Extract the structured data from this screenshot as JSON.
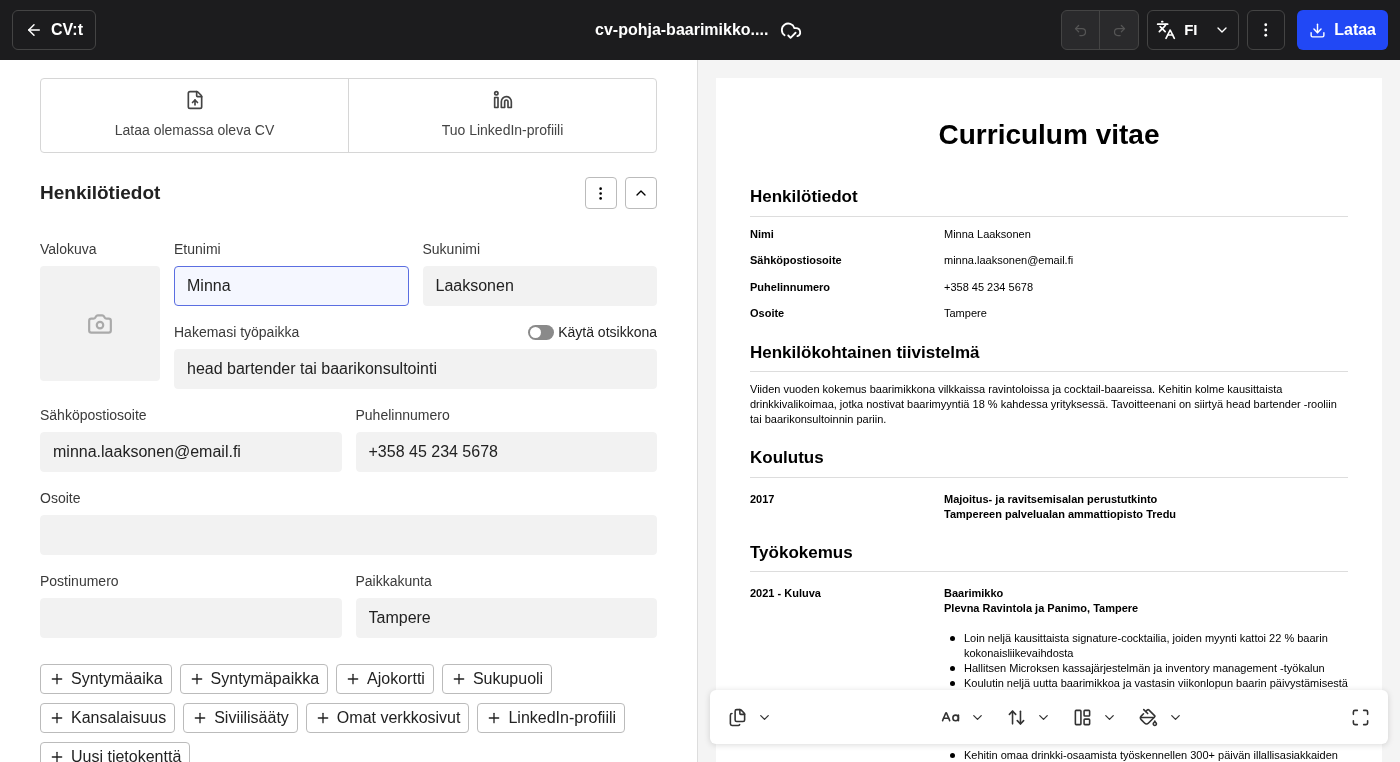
{
  "topbar": {
    "back_label": "CV:t",
    "file_name": "cv-pohja-baarimikko....",
    "language": "FI",
    "download_label": "Lataa"
  },
  "import_options": [
    {
      "kind": "upload",
      "label": "Lataa olemassa oleva CV"
    },
    {
      "kind": "linkedin",
      "label": "Tuo LinkedIn-profiili"
    }
  ],
  "section": {
    "title": "Henkilötiedot",
    "expanded": true
  },
  "photo": {
    "label": "Valokuva"
  },
  "fields": {
    "first_name": {
      "label": "Etunimi",
      "value": "Minna",
      "focused": true
    },
    "last_name": {
      "label": "Sukunimi",
      "value": "Laaksonen",
      "focused": false
    },
    "job": {
      "label": "Hakemasi työpaikka",
      "value": "head bartender tai baarikonsultointi",
      "focused": false
    },
    "email": {
      "label": "Sähköpostiosoite",
      "value": "minna.laaksonen@email.fi",
      "focused": false
    },
    "phone": {
      "label": "Puhelinnumero",
      "value": "+358 45 234 5678",
      "focused": false
    },
    "address": {
      "label": "Osoite",
      "focused": false
    },
    "postal": {
      "label": "Postinumero",
      "focused": false
    },
    "city": {
      "label": "Paikkakunta",
      "value": "Tampere",
      "focused": false
    }
  },
  "title_toggle": {
    "label": "Käytä otsikkona",
    "on": false
  },
  "add_buttons": [
    "Syntymäaika",
    "Syntymäpaikka",
    "Ajokortti",
    "Sukupuoli",
    "Kansalaisuus",
    "Siviilisääty",
    "Omat verkkosivut",
    "LinkedIn-profiili",
    "Uusi tietokenttä"
  ],
  "preview": {
    "title": "Curriculum vitae",
    "personal": {
      "heading": "Henkilötiedot",
      "rows": [
        {
          "label": "Nimi",
          "value": "Minna Laaksonen"
        },
        {
          "label": "Sähköpostiosoite",
          "value": "minna.laaksonen@email.fi"
        },
        {
          "label": "Puhelinnumero",
          "value": "+358 45 234 5678"
        },
        {
          "label": "Osoite",
          "value": "Tampere"
        }
      ]
    },
    "summary": {
      "heading": "Henkilökohtainen tiivistelmä",
      "text": "Viiden vuoden kokemus baarimikkona vilkkaissa ravintoloissa ja cocktail-baareissa. Kehitin kolme kausittaista drinkkivalikoimaa, jotka nostivat baarimyyntiä 18 % kahdessa yrityksessä. Tavoitteenani on siirtyä head bartender -rooliin tai baarikonsultoinnin pariin."
    },
    "education": {
      "heading": "Koulutus",
      "entries": [
        {
          "date": "2017",
          "title": "Majoitus- ja ravitsemisalan perustutkinto",
          "place": "Tampereen palvelualan ammattiopisto Tredu"
        }
      ]
    },
    "experience": {
      "heading": "Työkokemus",
      "entries": [
        {
          "date": "2021 - Kuluva",
          "title": "Baarimikko",
          "place": "Plevna Ravintola ja Panimo, Tampere",
          "bullets": [
            "Loin neljä kausittaista signature-cocktailia, joiden myynti kattoi 22 % baarin kokonaisliikevaihdosta",
            "Hallitsen Microksen kassajärjestelmän ja inventory management -työkalun",
            "Koulutin neljä uutta baarimikkoa ja vastasin viikonlopun baarin päivystämisestä",
            "Kehitin omaa drinkki-osaamista työskennellen 300+ päivän illallisasiakkaiden"
          ]
        }
      ]
    }
  }
}
